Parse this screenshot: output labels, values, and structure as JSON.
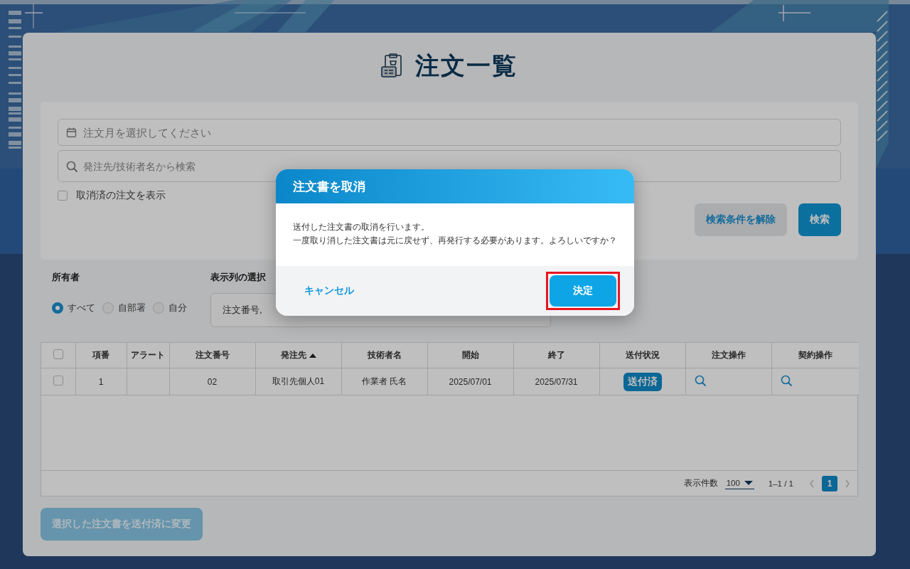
{
  "page": {
    "title": "注文一覧"
  },
  "filters": {
    "month_field": {
      "placeholder": "注文月を選択してください"
    },
    "search_field": {
      "placeholder": "発注先/技術者名から検索"
    },
    "show_cancelled": {
      "label": "取消済の注文を表示",
      "checked": false
    },
    "buttons": [
      {
        "label": "検索条件を解除",
        "kind": "secondary"
      },
      {
        "label": "検索",
        "kind": "primary"
      }
    ]
  },
  "owner": {
    "label": "所有者",
    "options": [
      {
        "label": "すべて",
        "selected": true
      },
      {
        "label": "自部署",
        "selected": false
      },
      {
        "label": "自分",
        "selected": false
      }
    ]
  },
  "columns_select": {
    "label": "表示列の選択",
    "value": "注文番号,"
  },
  "table": {
    "select_all_checked": false,
    "columns": [
      {
        "label": "項番",
        "sorted": false
      },
      {
        "label": "アラート",
        "sorted": false
      },
      {
        "label": "注文番号",
        "sorted": false
      },
      {
        "label": "発注先",
        "sorted": true
      },
      {
        "label": "技術者名",
        "sorted": false
      },
      {
        "label": "開始",
        "sorted": false
      },
      {
        "label": "終了",
        "sorted": false
      },
      {
        "label": "送付状況",
        "sorted": false
      },
      {
        "label": "注文操作",
        "sorted": false
      },
      {
        "label": "契約操作",
        "sorted": false
      }
    ],
    "rows": [
      {
        "checked": false,
        "number": "1",
        "order_no": "02",
        "supplier": "取引先個人01",
        "engineer": "作業者 氏名",
        "start": "2025/07/01",
        "end": "2025/07/31",
        "status": "送付済"
      }
    ],
    "footer": {
      "per_page_label": "表示件数",
      "per_page": "100",
      "range": "1–1 / 1",
      "pages": [
        {
          "label": "1",
          "selected": true
        }
      ]
    }
  },
  "bulk_button": {
    "label": "選択した注文書を送付済に変更",
    "disabled": true
  },
  "dialog": {
    "title": "注文書を取消",
    "message": [
      "送付した注文書の取消を行います。",
      "一度取り消した注文書は元に戻せず、再発行する必要があります。よろしいですか？"
    ],
    "cancel": "キャンセル",
    "confirm": {
      "label": "決定",
      "highlighted": true
    }
  }
}
